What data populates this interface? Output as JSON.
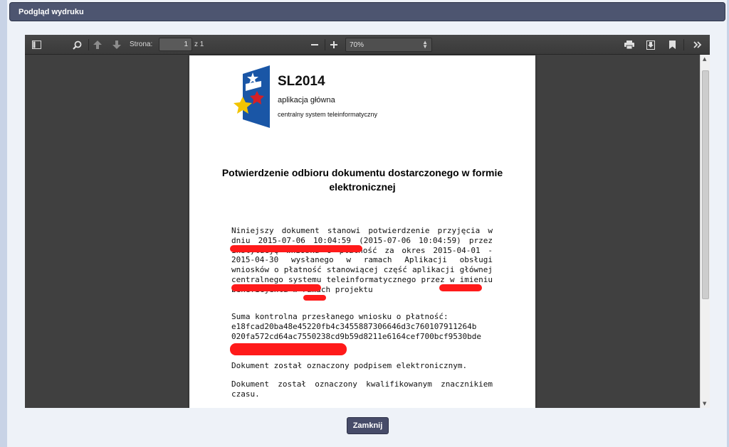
{
  "dialog": {
    "title": "Podgląd wydruku",
    "close_label": "Zamknij"
  },
  "toolbar": {
    "page_label": "Strona:",
    "page_value": "1",
    "page_total": "z 1",
    "zoom": "70%",
    "icons": [
      "sidebar-toggle-icon",
      "search-icon",
      "arrow-up-icon",
      "arrow-down-icon",
      "zoom-out-icon",
      "zoom-in-icon",
      "print-icon",
      "download-icon",
      "bookmark-icon",
      "tools-icon"
    ]
  },
  "document": {
    "brand": "SL2014",
    "brand_sub1": "aplikacja główna",
    "brand_sub2": "centralny system teleinformatyczny",
    "title": "Potwierdzenie odbioru dokumentu dostarczonego w formie elektronicznej",
    "paragraph1": "Niniejszy dokument stanowi potwierdzenie przyjęcia w dniu 2015-07-06 10:04:59 (2015-07-06 10:04:59) przez instytucję wniosku o płatność za okres 2015-04-01 - 2015-04-30 wysłanego w ramach Aplikacji obsługi wniosków o płatność stanowiącej część aplikacji głównej centralnego systemu teleinformatycznego przez w imieniu beneficjenta w ramach projektu",
    "checksum_label": "Suma kontrolna przesłanego wniosku o płatność:",
    "checksum_line1": "e18fcad20ba48e45220fb4c3455887306646d3c760107911264b",
    "checksum_line2": "020fa572cd64ac7550238cd9b59d8211e6164cef700bcf9530bde",
    "signature_note": "Dokument został oznaczony podpisem elektronicznym.",
    "timestamp_note": "Dokument został oznaczony kwalifikowanym znacznikiem czasu."
  },
  "colors": {
    "header_bg": "#4d5570",
    "viewer_bg": "#404040",
    "redaction": "#ff1a1a"
  }
}
